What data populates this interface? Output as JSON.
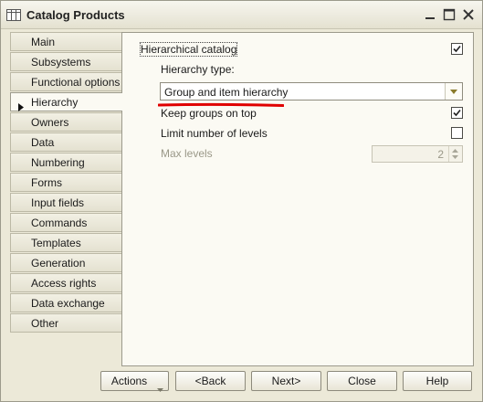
{
  "window": {
    "title": "Catalog Products"
  },
  "tabs": [
    {
      "label": "Main"
    },
    {
      "label": "Subsystems"
    },
    {
      "label": "Functional options"
    },
    {
      "label": "Hierarchy"
    },
    {
      "label": "Owners"
    },
    {
      "label": "Data"
    },
    {
      "label": "Numbering"
    },
    {
      "label": "Forms"
    },
    {
      "label": "Input fields"
    },
    {
      "label": "Commands"
    },
    {
      "label": "Templates"
    },
    {
      "label": "Generation"
    },
    {
      "label": "Access rights"
    },
    {
      "label": "Data exchange"
    },
    {
      "label": "Other"
    }
  ],
  "active_tab": "Hierarchy",
  "hierarchy": {
    "hierarchical_catalog_label": "Hierarchical catalog",
    "hierarchical_catalog_checked": true,
    "hierarchy_type_label": "Hierarchy type:",
    "hierarchy_type_value": "Group and item hierarchy",
    "keep_groups_on_top_label": "Keep groups on top",
    "keep_groups_on_top_checked": true,
    "limit_levels_label": "Limit number of levels",
    "limit_levels_checked": false,
    "max_levels_label": "Max levels",
    "max_levels_value": "2"
  },
  "buttons": {
    "actions": "Actions",
    "back": "<Back",
    "next": "Next>",
    "close": "Close",
    "help": "Help"
  },
  "colors": {
    "annotation_underline": "#e00000",
    "window_bg": "#ece9d8"
  },
  "icons": [
    "table-icon",
    "minimize-icon",
    "maximize-icon",
    "close-icon",
    "checkmark-icon",
    "chevron-down-icon",
    "spin-up-icon",
    "spin-down-icon",
    "triangle-right-icon"
  ]
}
